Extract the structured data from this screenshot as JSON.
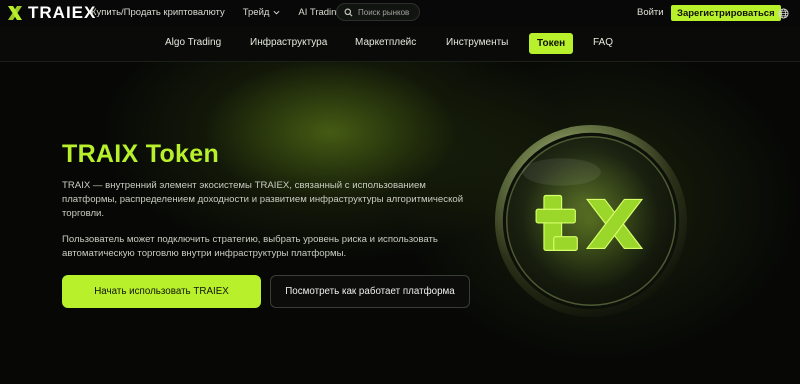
{
  "brand": {
    "name": "TRAIEX",
    "accent": "#b8f02b"
  },
  "topnav": {
    "items": [
      {
        "label": "Купить/Продать криптовалюту",
        "dropdown": false
      },
      {
        "label": "Трейд",
        "dropdown": true
      },
      {
        "label": "AI Trading",
        "dropdown": false
      }
    ],
    "search_placeholder": "Поиск рынков",
    "login_label": "Войти",
    "register_label": "Зарегистрироваться"
  },
  "subnav": {
    "tabs": [
      {
        "label": "Algo Trading",
        "active": false
      },
      {
        "label": "Инфраструктура",
        "active": false
      },
      {
        "label": "Маркетплейс",
        "active": false
      },
      {
        "label": "Инструменты",
        "active": false
      },
      {
        "label": "Токен",
        "active": true
      },
      {
        "label": "FAQ",
        "active": false
      }
    ]
  },
  "hero": {
    "title": "TRAIX Token",
    "paragraph1": "TRAIX — внутренний элемент экосистемы TRAIEX, связанный с использованием платформы, распределением доходности и развитием инфраструктуры алгоритмической торговли.",
    "paragraph2": "Пользователь может подключить стратегию, выбрать уровень риска и использовать автоматическую торговлю внутри инфраструктуры платформы.",
    "primary_button": "Начать использовать TRAIEX",
    "secondary_button": "Посмотреть как работает платформа"
  },
  "icons": {
    "logo": "traiex-x-logo-icon",
    "search": "search-icon",
    "globe": "globe-icon",
    "chevron": "chevron-down-icon",
    "coin": "traix-coin-icon"
  }
}
